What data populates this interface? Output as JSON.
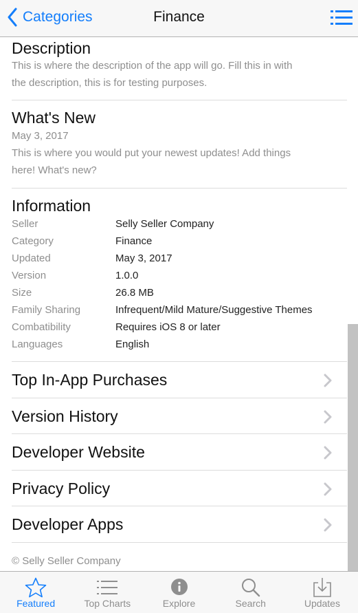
{
  "navbar": {
    "back_label": "Categories",
    "title": "Finance",
    "menu_icon": "list-icon",
    "accent": "#147efb"
  },
  "description": {
    "heading": "Description",
    "lines": [
      "This is where the description of the app will go. Fill this in with",
      "the description, this is for testing purposes."
    ]
  },
  "whats_new": {
    "heading": "What's New",
    "date": "May 3, 2017",
    "lines": [
      "This is where you would put your newest updates! Add things",
      "here! What's new?"
    ]
  },
  "information": {
    "heading": "Information",
    "rows": [
      {
        "label": "Seller",
        "value": "Selly Seller Company"
      },
      {
        "label": "Category",
        "value": "Finance"
      },
      {
        "label": "Updated",
        "value": "May 3, 2017"
      },
      {
        "label": "Version",
        "value": "1.0.0"
      },
      {
        "label": "Size",
        "value": "26.8 MB"
      },
      {
        "label": "Family Sharing",
        "value": "Infrequent/Mild Mature/Suggestive Themes"
      },
      {
        "label": "Combatibility",
        "value": "Requires iOS 8 or later"
      },
      {
        "label": "Languages",
        "value": "English"
      }
    ]
  },
  "links": [
    {
      "label": "Top In-App Purchases"
    },
    {
      "label": "Version History"
    },
    {
      "label": "Developer Website"
    },
    {
      "label": "Privacy Policy"
    },
    {
      "label": "Developer Apps"
    }
  ],
  "copyright": "© Selly Seller Company",
  "tabbar": {
    "items": [
      {
        "label": "Featured",
        "icon": "star-icon",
        "active": true
      },
      {
        "label": "Top Charts",
        "icon": "list-icon",
        "active": false
      },
      {
        "label": "Explore",
        "icon": "info-icon",
        "active": false
      },
      {
        "label": "Search",
        "icon": "search-icon",
        "active": false
      },
      {
        "label": "Updates",
        "icon": "download-icon",
        "active": false
      }
    ]
  }
}
